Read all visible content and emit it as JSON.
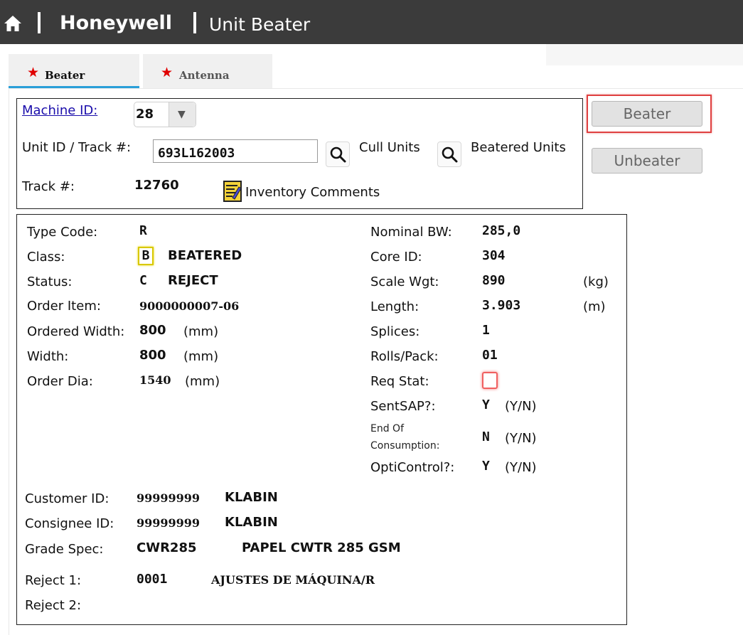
{
  "header": {
    "brand": "Honeywell",
    "title": "Unit Beater"
  },
  "tabs": [
    {
      "label": "Beater",
      "active": true
    },
    {
      "label": "Antenna",
      "active": false
    }
  ],
  "machine": {
    "machine_id_label": "Machine ID:",
    "machine_id_value": "28",
    "unit_track_label": "Unit ID / Track #:",
    "unit_id_value": "693L162003",
    "cull_units_label": "Cull Units",
    "beatered_units_label": "Beatered Units",
    "track_label": "Track #:",
    "track_value": "12760",
    "inventory_comments_label": "Inventory Comments"
  },
  "actions": {
    "beater_label": "Beater",
    "unbeater_label": "Unbeater"
  },
  "details": {
    "type_code": {
      "label": "Type Code:",
      "value": "R"
    },
    "class": {
      "label": "Class:",
      "code": "B",
      "text": "BEATERED"
    },
    "status": {
      "label": "Status:",
      "code": "C",
      "text": "REJECT"
    },
    "order_item": {
      "label": "Order Item:",
      "value": "9000000007-06"
    },
    "ordered_width": {
      "label": "Ordered Width:",
      "value": "800",
      "unit": "(mm)"
    },
    "width": {
      "label": "Width:",
      "value": "800",
      "unit": "(mm)"
    },
    "order_dia": {
      "label": "Order Dia:",
      "value": "1540",
      "unit": "(mm)"
    },
    "nominal_bw": {
      "label": "Nominal BW:",
      "value": "285,0"
    },
    "core_id": {
      "label": "Core ID:",
      "value": "304"
    },
    "scale_wgt": {
      "label": "Scale Wgt:",
      "value": "890",
      "unit": "(kg)"
    },
    "length": {
      "label": "Length:",
      "value": "3.903",
      "unit": "(m)"
    },
    "splices": {
      "label": "Splices:",
      "value": "1"
    },
    "rolls_pack": {
      "label": "Rolls/Pack:",
      "value": "01"
    },
    "req_stat": {
      "label": "Req Stat:"
    },
    "sent_sap": {
      "label": "SentSAP?:",
      "value": "Y",
      "unit": "(Y/N)"
    },
    "end_of_consumption": {
      "label_line1": "End Of",
      "label_line2": "Consumption:",
      "value": "N",
      "unit": "(Y/N)"
    },
    "opti_control": {
      "label": "OptiControl?:",
      "value": "Y",
      "unit": "(Y/N)"
    },
    "customer_id": {
      "label": "Customer ID:",
      "value": "99999999",
      "name": "KLABIN"
    },
    "consignee_id": {
      "label": "Consignee ID:",
      "value": "99999999",
      "name": "KLABIN"
    },
    "grade_spec": {
      "label": "Grade Spec:",
      "value": "CWR285",
      "desc": "PAPEL CWTR 285 GSM"
    },
    "reject1": {
      "label": "Reject 1:",
      "value": "0001",
      "desc": "AJUSTES DE MÁQUINA/R"
    },
    "reject2": {
      "label": "Reject 2:"
    }
  },
  "colors": {
    "header_bg": "#3b3b3b",
    "tab_active_underline": "#2a9fd8",
    "star": "#e00000",
    "link": "#1a0dab",
    "highlight_border": "#e04040",
    "class_badge_border": "#d8c800"
  },
  "icons": [
    "home-icon",
    "star-icon",
    "chevron-down-icon",
    "search-icon",
    "inventory-comments-icon"
  ]
}
